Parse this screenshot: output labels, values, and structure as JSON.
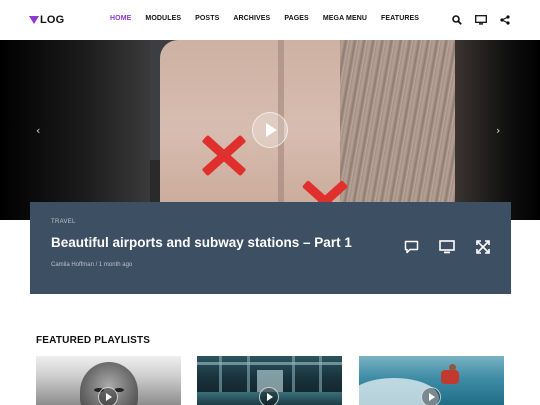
{
  "brand": {
    "logo_text": "LOG",
    "accent": "#8e3bd1"
  },
  "nav": {
    "items": [
      {
        "label": "HOME",
        "active": true
      },
      {
        "label": "MODULES",
        "active": false
      },
      {
        "label": "POSTS",
        "active": false
      },
      {
        "label": "ARCHIVES",
        "active": false
      },
      {
        "label": "PAGES",
        "active": false
      },
      {
        "label": "MEGA MENU",
        "active": false
      },
      {
        "label": "FEATURES",
        "active": false
      }
    ],
    "icons": [
      "search-icon",
      "monitor-icon",
      "share-icon"
    ]
  },
  "hero": {
    "prev_icon": "‹",
    "next_icon": "›",
    "category": "TRAVEL",
    "title": "Beautiful airports and subway stations – Part 1",
    "meta": "Camila Hoffman / 1 month ago",
    "panel_color": "#3d4f63",
    "panel_icons": [
      "comment-icon",
      "monitor-icon",
      "expand-icon"
    ]
  },
  "featured": {
    "heading": "FEATURED PLAYLISTS"
  }
}
